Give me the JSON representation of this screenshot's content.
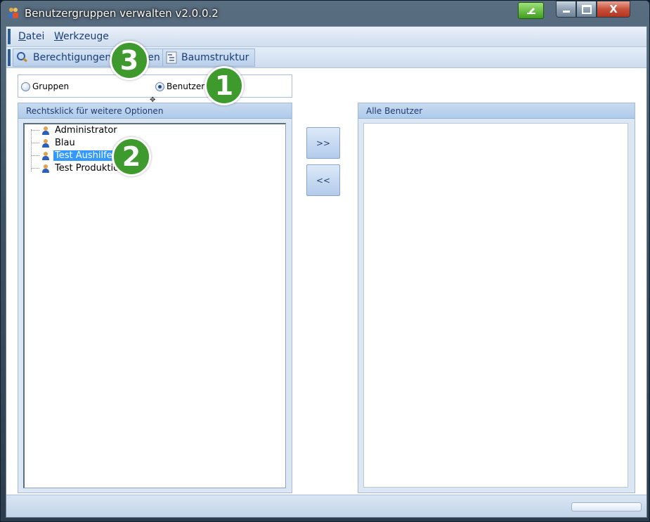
{
  "window": {
    "title": "Benutzergruppen verwalten v2.0.0.2",
    "close_glyph": "X"
  },
  "menubar": {
    "items": [
      {
        "label": "Datei",
        "underline": "D",
        "rest": "atei"
      },
      {
        "label": "Werkzeuge",
        "underline": "W",
        "rest": "erkzeuge"
      }
    ]
  },
  "toolbar": {
    "permissions_label": "Berechtigungen verwalten",
    "permissions_visible_a": "Berechtigungen ",
    "permissions_visible_b": "en",
    "tree_label": "Baumstruktur"
  },
  "mode": {
    "options": [
      "Gruppen",
      "Benutzer"
    ],
    "selected": "Benutzer"
  },
  "left_panel": {
    "title": "Rechtsklick für weitere Optionen",
    "users": [
      {
        "name": "Administrator",
        "selected": false
      },
      {
        "name": "Blau",
        "selected": false
      },
      {
        "name": "Test Aushilfe",
        "selected": true
      },
      {
        "name": "Test Produktio.",
        "selected": false
      }
    ]
  },
  "buttons": {
    "add": ">>",
    "remove": "<<"
  },
  "right_panel": {
    "title": "Alle Benutzer"
  },
  "callouts": [
    "1",
    "2",
    "3"
  ],
  "colors": {
    "callout": "#3e9a2c",
    "selection": "#3399ff",
    "accent": "#1e3c6e"
  }
}
